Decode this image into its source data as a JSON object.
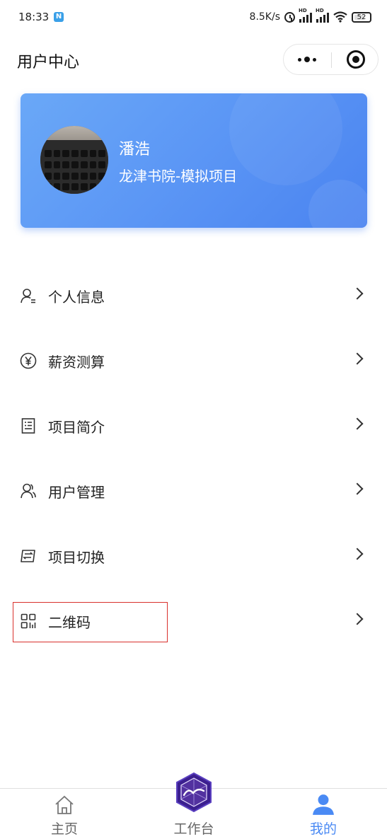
{
  "status_bar": {
    "time": "18:33",
    "app_icon": "N",
    "speed": "8.5K/s",
    "hd1": "HD",
    "hd2": "HD",
    "battery": "52"
  },
  "header": {
    "title": "用户中心"
  },
  "profile": {
    "name": "潘浩",
    "organization": "龙津书院-模拟项目",
    "card_color": "#5b96f5"
  },
  "menu": {
    "items": [
      {
        "label": "个人信息",
        "icon": "person-icon"
      },
      {
        "label": "薪资测算",
        "icon": "yen-icon"
      },
      {
        "label": "项目简介",
        "icon": "document-icon"
      },
      {
        "label": "用户管理",
        "icon": "users-icon"
      },
      {
        "label": "项目切换",
        "icon": "switch-icon"
      },
      {
        "label": "二维码",
        "icon": "qrcode-icon"
      }
    ]
  },
  "tabbar": {
    "items": [
      {
        "label": "主页",
        "icon": "home-icon",
        "active": false
      },
      {
        "label": "工作台",
        "icon": "workbench-logo",
        "active": false
      },
      {
        "label": "我的",
        "icon": "user-icon",
        "active": true
      }
    ],
    "active_color": "#4a8af4",
    "inactive_color": "#666666"
  }
}
